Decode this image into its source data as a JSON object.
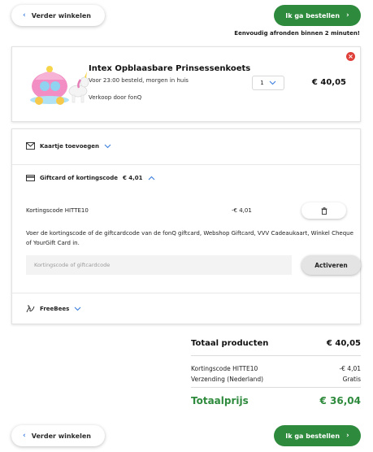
{
  "nav": {
    "back_label": "Verder winkelen",
    "order_label": "Ik ga bestellen",
    "tagline": "Eenvoudig afronden binnen 2 minuten!"
  },
  "product": {
    "title": "Intex Opblaasbare Prinsessenkoets",
    "delivery": "Voor 23:00 besteld, morgen in huis",
    "seller": "Verkoop door fonQ",
    "quantity": "1",
    "price": "€ 40,05"
  },
  "options": {
    "card_label": "Kaartje toevoegen",
    "giftcard_label": "Giftcard of kortingscode",
    "giftcard_amount": "€ 4,01",
    "code_name": "Kortingscode HITTE10",
    "code_amount": "-€ 4,01",
    "explanation": "Voer de kortingscode of de giftcardcode van de fonQ giftcard, Webshop Giftcard, VVV Cadeaukaart, Winkel Cheque of YourGift Card in.",
    "code_placeholder": "Kortingscode of giftcardcode",
    "activate_label": "Activeren",
    "freebees_label": "FreeBees"
  },
  "summary": {
    "products_label": "Totaal producten",
    "products_value": "€ 40,05",
    "discount_label": "Kortingscode HITTE10",
    "discount_value": "-€ 4,01",
    "shipping_label": "Verzending (Nederland)",
    "shipping_value": "Gratis",
    "total_label": "Totaalprijs",
    "total_value": "€ 36,04"
  },
  "colors": {
    "accent_green": "#2e8a3c",
    "link_blue": "#3b7ddd",
    "remove_red": "#e0403a"
  }
}
